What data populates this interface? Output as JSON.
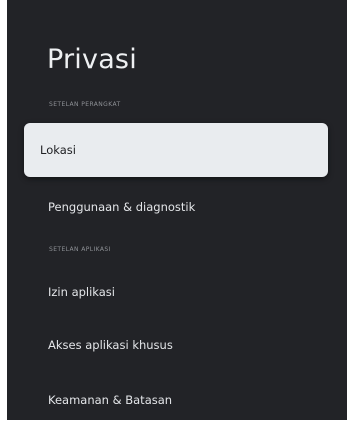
{
  "page": {
    "title": "Privasi"
  },
  "sections": [
    {
      "header": "SETELAN PERANGKAT",
      "items": [
        "Lokasi",
        "Penggunaan & diagnostik"
      ]
    },
    {
      "header": "SETELAN APLIKASI",
      "items": [
        "Izin aplikasi",
        "Akses aplikasi khusus",
        "Keamanan & Batasan"
      ]
    }
  ],
  "focused_item": "Lokasi",
  "colors": {
    "background": "#222327",
    "focused_item_bg": "#e9ecef",
    "text": "#e3e5e8",
    "section_header": "#8e9196"
  }
}
